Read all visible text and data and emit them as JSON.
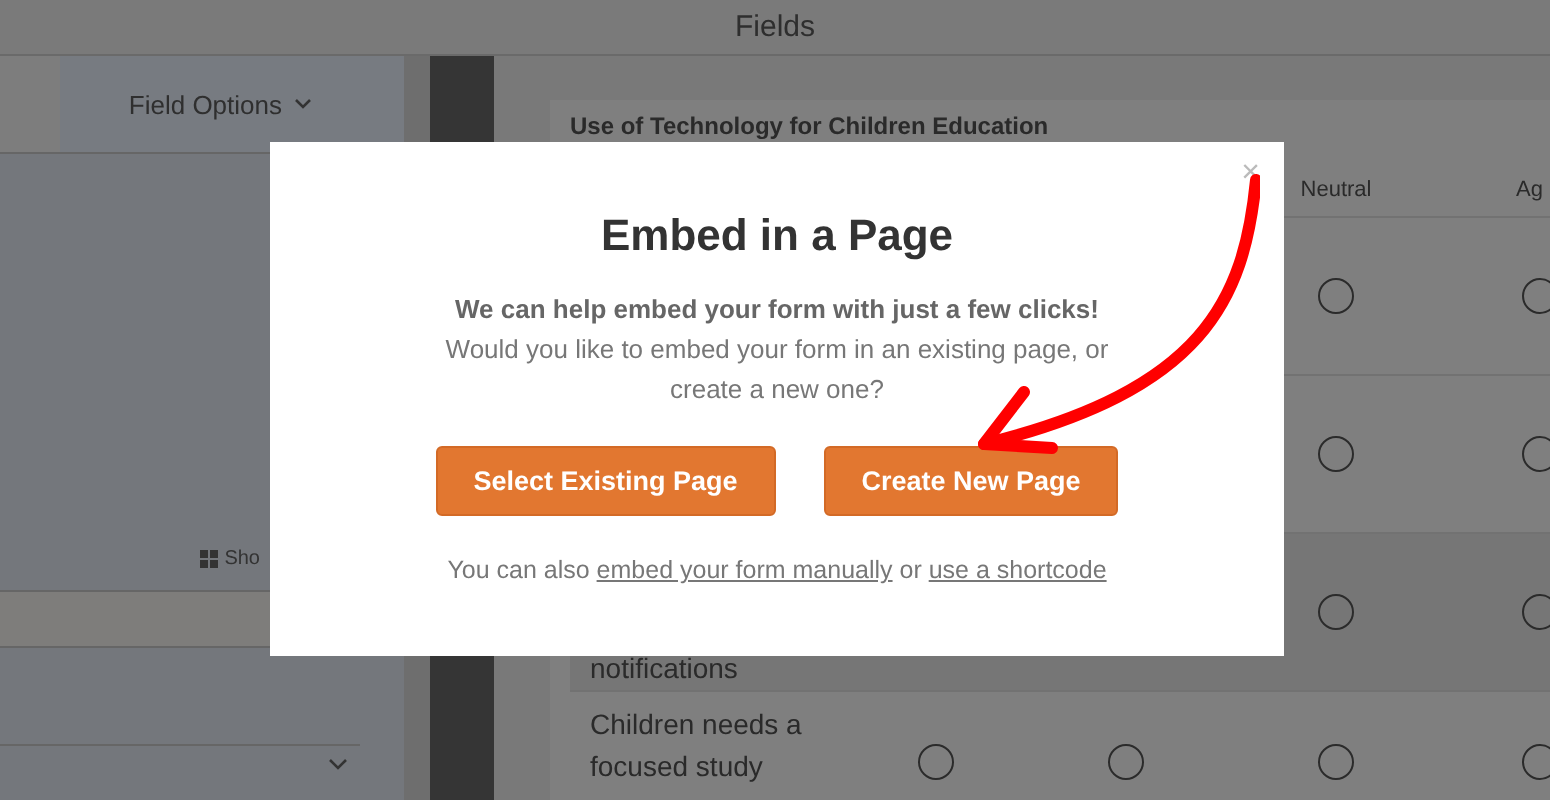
{
  "header": {
    "title": "Fields"
  },
  "left_panel": {
    "tab": {
      "label": "Field Options"
    },
    "show_link": {
      "label": "Sho"
    }
  },
  "form": {
    "question": "Use of Technology for Children Education",
    "columns": [
      {
        "label": "Neutral"
      },
      {
        "label": "Ag"
      }
    ],
    "rows": [
      {
        "choices": [
          {
            "selected": false
          },
          {
            "selected": false
          }
        ]
      },
      {
        "choices": [
          {
            "selected": false
          },
          {
            "selected": false
          }
        ]
      },
      {
        "label": "notifications",
        "choices": [
          {
            "selected": false
          },
          {
            "selected": false
          }
        ]
      },
      {
        "label": "Children needs a focused study",
        "choices": [
          {
            "selected": false
          },
          {
            "selected": false
          },
          {
            "selected": false
          },
          {
            "selected": false
          }
        ]
      }
    ]
  },
  "modal": {
    "title": "Embed in a Page",
    "lead": "We can help embed your form with just a few clicks!",
    "question": "Would you like to embed your form in an existing page, or create a new one?",
    "buttons": [
      {
        "label": "Select Existing Page"
      },
      {
        "label": "Create New Page"
      }
    ],
    "footer": [
      {
        "kind": "text",
        "text": "You can also "
      },
      {
        "kind": "link",
        "text": "embed your form manually"
      },
      {
        "kind": "text",
        "text": " or "
      },
      {
        "kind": "link",
        "text": "use a shortcode"
      }
    ],
    "close": "×"
  }
}
